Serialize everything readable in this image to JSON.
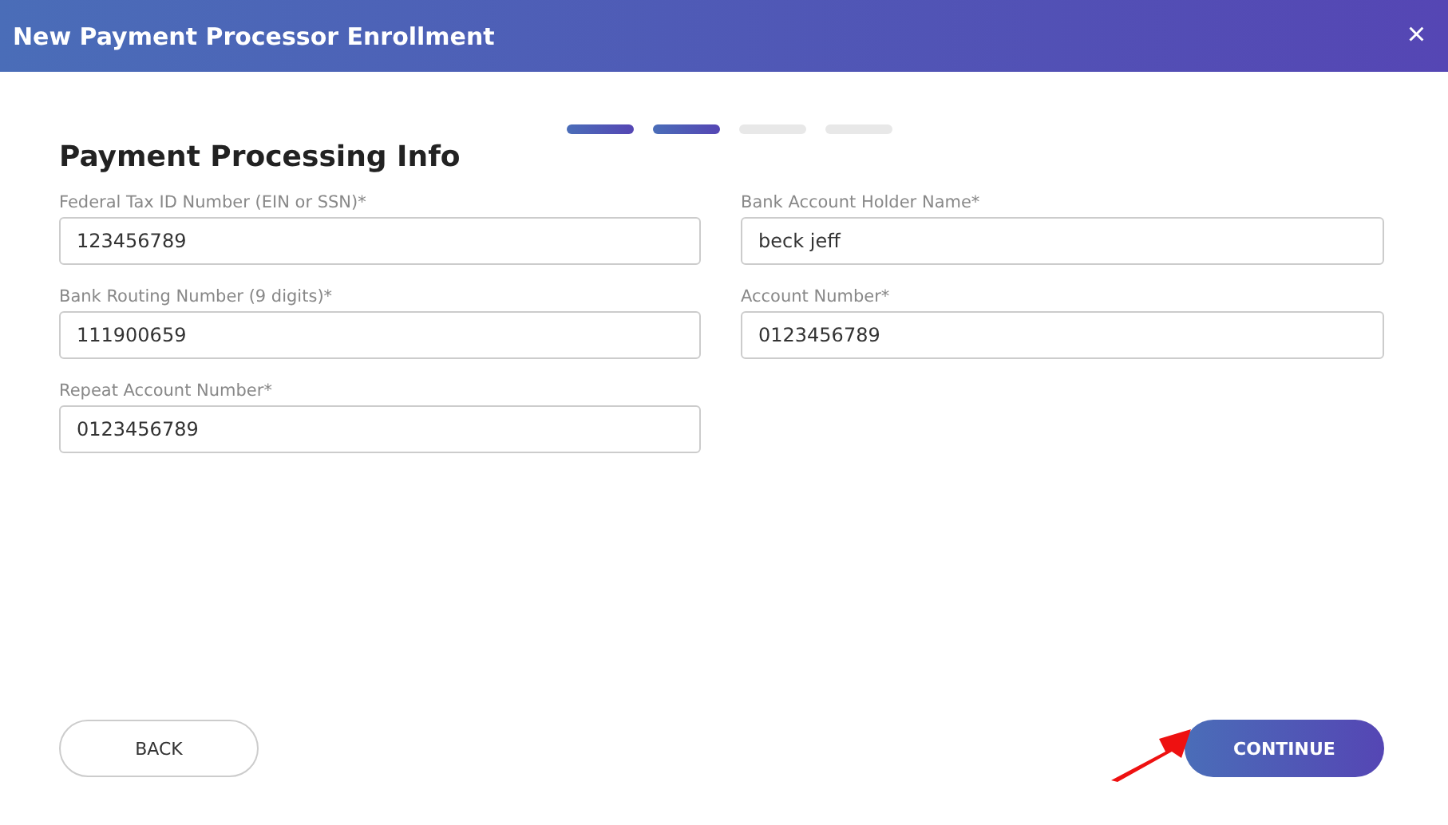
{
  "window": {
    "title": "New Payment Processor Enrollment",
    "close": "×"
  },
  "steps": [
    {
      "done": true
    },
    {
      "done": true
    },
    {
      "done": false
    },
    {
      "done": false
    }
  ],
  "section_title": "Payment Processing Info",
  "fields": [
    {
      "label": "Federal Tax ID Number (EIN or SSN)*",
      "value": "123456789"
    },
    {
      "label": "Bank Account Holder Name*",
      "value": "beck jeff"
    },
    {
      "label": "Bank Routing Number (9 digits)*",
      "value": "111900659"
    },
    {
      "label": "Account Number*",
      "value": "0123456789"
    },
    {
      "label": "Repeat Account Number*",
      "value": "0123456789"
    }
  ],
  "buttons": [
    {
      "kind": "secondary",
      "label": "BACK"
    },
    {
      "kind": "primary",
      "label": "CONTINUE"
    }
  ]
}
